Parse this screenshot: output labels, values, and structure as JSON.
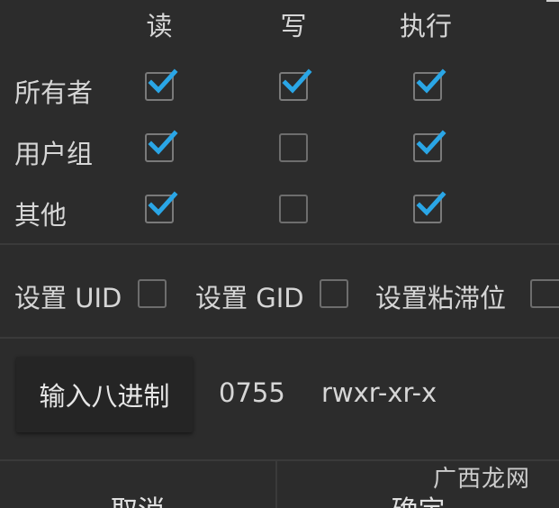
{
  "columns": {
    "read": "读",
    "write": "写",
    "execute": "执行"
  },
  "rows": [
    {
      "label": "所有者",
      "read": true,
      "write": true,
      "execute": true
    },
    {
      "label": "用户组",
      "read": true,
      "write": false,
      "execute": true
    },
    {
      "label": "其他",
      "read": true,
      "write": false,
      "execute": true
    }
  ],
  "special": {
    "setuid_label": "设置 UID",
    "setuid": false,
    "setgid_label": "设置 GID",
    "setgid": false,
    "sticky_label": "设置粘滞位",
    "sticky": false
  },
  "octal": {
    "button_label": "输入八进制",
    "value": "0755",
    "symbolic": "rwxr-xr-x"
  },
  "buttons": {
    "cancel": "取消",
    "ok": "确定"
  },
  "watermark": "广西龙网",
  "colors": {
    "accent": "#2aa6e6",
    "background": "#2c2c2c"
  }
}
